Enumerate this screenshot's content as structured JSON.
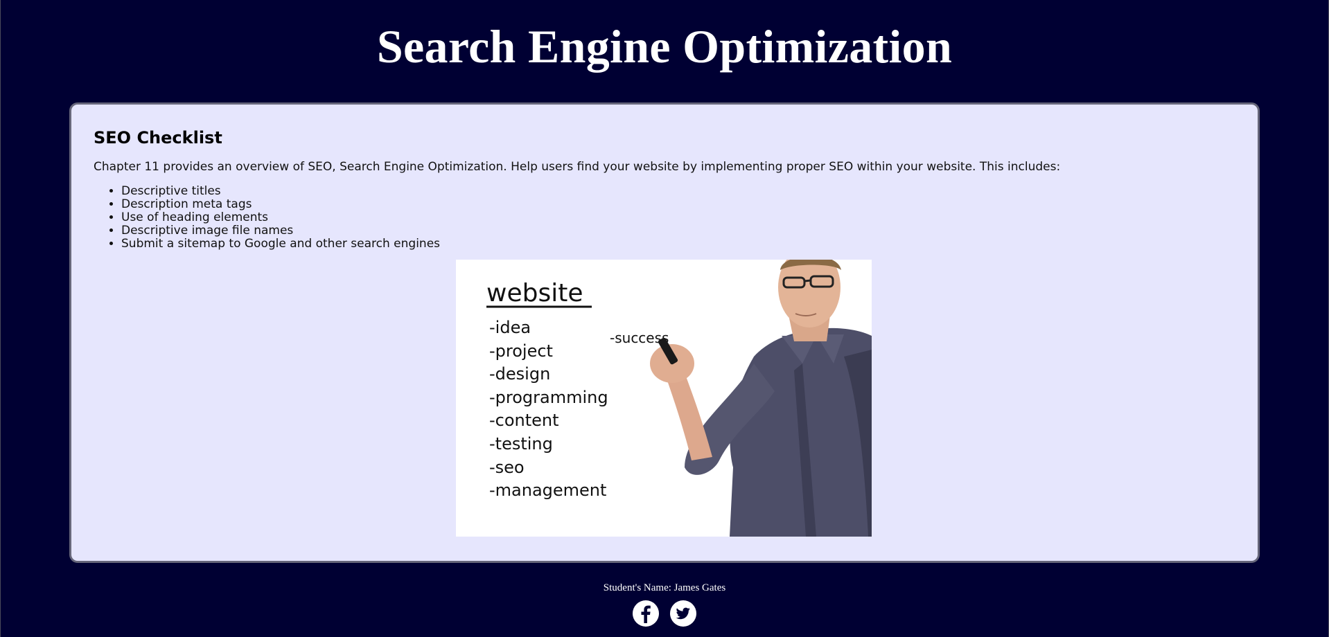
{
  "header": {
    "title": "Search Engine Optimization"
  },
  "main": {
    "heading": "SEO Checklist",
    "intro": "Chapter 11 provides an overview of SEO, Search Engine Optimization. Help users find your website by implementing proper SEO within your website. This includes:",
    "checklist": [
      "Descriptive titles",
      "Description meta tags",
      "Use of heading elements",
      "Descriptive image file names",
      "Submit a sitemap to Google and other search engines"
    ],
    "image": {
      "board_title": "website",
      "board_items": [
        "-idea",
        "-project",
        "-design",
        "-programming",
        "-content",
        "-testing",
        "-seo",
        "-management"
      ],
      "board_extra": "-success"
    }
  },
  "footer": {
    "student": "Student's Name: James Gates",
    "social": [
      {
        "icon": "facebook-icon"
      },
      {
        "icon": "twitter-icon"
      }
    ]
  },
  "colors": {
    "page_background": "#000033",
    "card_background": "#e6e6fd",
    "card_border": "#66667a",
    "text_light": "#ffffff"
  }
}
